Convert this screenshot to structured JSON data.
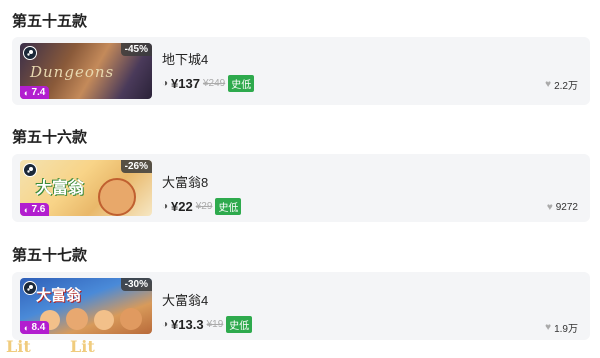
{
  "sections": [
    {
      "title": "第五十五款",
      "game": {
        "name": "地下城4",
        "thumb_text": "Dungeons",
        "discount": "-45%",
        "rating": "7.4",
        "price": "¥137",
        "original_price": "¥249",
        "lowest_badge": "史低",
        "likes": "2.2万"
      }
    },
    {
      "title": "第五十六款",
      "game": {
        "name": "大富翁8",
        "thumb_text": "大富翁",
        "discount": "-26%",
        "rating": "7.6",
        "price": "¥22",
        "original_price": "¥29",
        "lowest_badge": "史低",
        "likes": "9272"
      }
    },
    {
      "title": "第五十七款",
      "game": {
        "name": "大富翁4",
        "thumb_text": "大富翁",
        "discount": "-30%",
        "rating": "8.4",
        "price": "¥13.3",
        "original_price": "¥19",
        "lowest_badge": "史低",
        "likes": "1.9万"
      }
    }
  ],
  "colors": {
    "rating_bg": "#b21ecf",
    "lowest_bg": "#2eaa4d",
    "card_bg": "#f4f5f7"
  },
  "watermark": "Lit"
}
